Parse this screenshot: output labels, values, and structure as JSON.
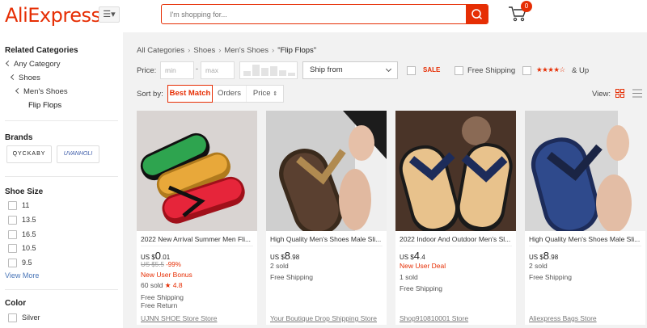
{
  "header": {
    "logo": "AliExpress",
    "search_placeholder": "I'm shopping for...",
    "cart_count": "0",
    "brand_color": "#e62e04"
  },
  "sidebar": {
    "related_title": "Related Categories",
    "categories": [
      "Any Category",
      "Shoes",
      "Men's Shoes",
      "Flip Flops"
    ],
    "brands_title": "Brands",
    "brands": [
      "QYCKABY",
      "UVANHOLI"
    ],
    "size_title": "Shoe Size",
    "sizes": [
      "11",
      "13.5",
      "16.5",
      "10.5",
      "9.5"
    ],
    "view_more": "View More",
    "color_title": "Color",
    "colors": [
      "Silver"
    ]
  },
  "main": {
    "breadcrumb": [
      "All Categories",
      "Shoes",
      "Men's Shoes",
      "\"Flip Flops\""
    ],
    "price_label": "Price:",
    "price_min_placeholder": "min",
    "price_max_placeholder": "max",
    "price_dash": "-",
    "ship_from": "Ship from",
    "sale_label": "SALE",
    "free_shipping_label": "Free Shipping",
    "rating_stars": "★★★★☆",
    "rating_label": "& Up",
    "sort_label": "Sort by:",
    "sort_options": [
      "Best Match",
      "Orders",
      "Price"
    ],
    "view_label": "View:"
  },
  "products": [
    {
      "title": "2022 New Arrival Summer Men Fli...",
      "currency": "US $",
      "price_int": "0",
      "price_dec": ".01",
      "orig_price": "US $5.5",
      "discount": "-99%",
      "promo": "New User Bonus",
      "sold": "60 sold",
      "rating": "★ 4.8",
      "shipping": "Free Shipping",
      "returns": "Free Return",
      "store": "UJNN SHOE Store Store"
    },
    {
      "title": "High Quality Men's Shoes Male Sli...",
      "currency": "US $",
      "price_int": "8",
      "price_dec": ".98",
      "sold": "2 sold",
      "shipping": "Free Shipping",
      "store": "Your Boutique Drop Shipping Store"
    },
    {
      "title": "2022 Indoor And Outdoor Men's Sl...",
      "currency": "US $",
      "price_int": "4",
      "price_dec": ".4",
      "promo": "New User Deal",
      "sold": "1 sold",
      "shipping": "Free Shipping",
      "store": "Shop910810001 Store"
    },
    {
      "title": "High Quality Men's Shoes Male Sli...",
      "currency": "US $",
      "price_int": "8",
      "price_dec": ".98",
      "sold": "2 sold",
      "shipping": "Free Shipping",
      "store": "Aliexpress Bags Store"
    }
  ]
}
